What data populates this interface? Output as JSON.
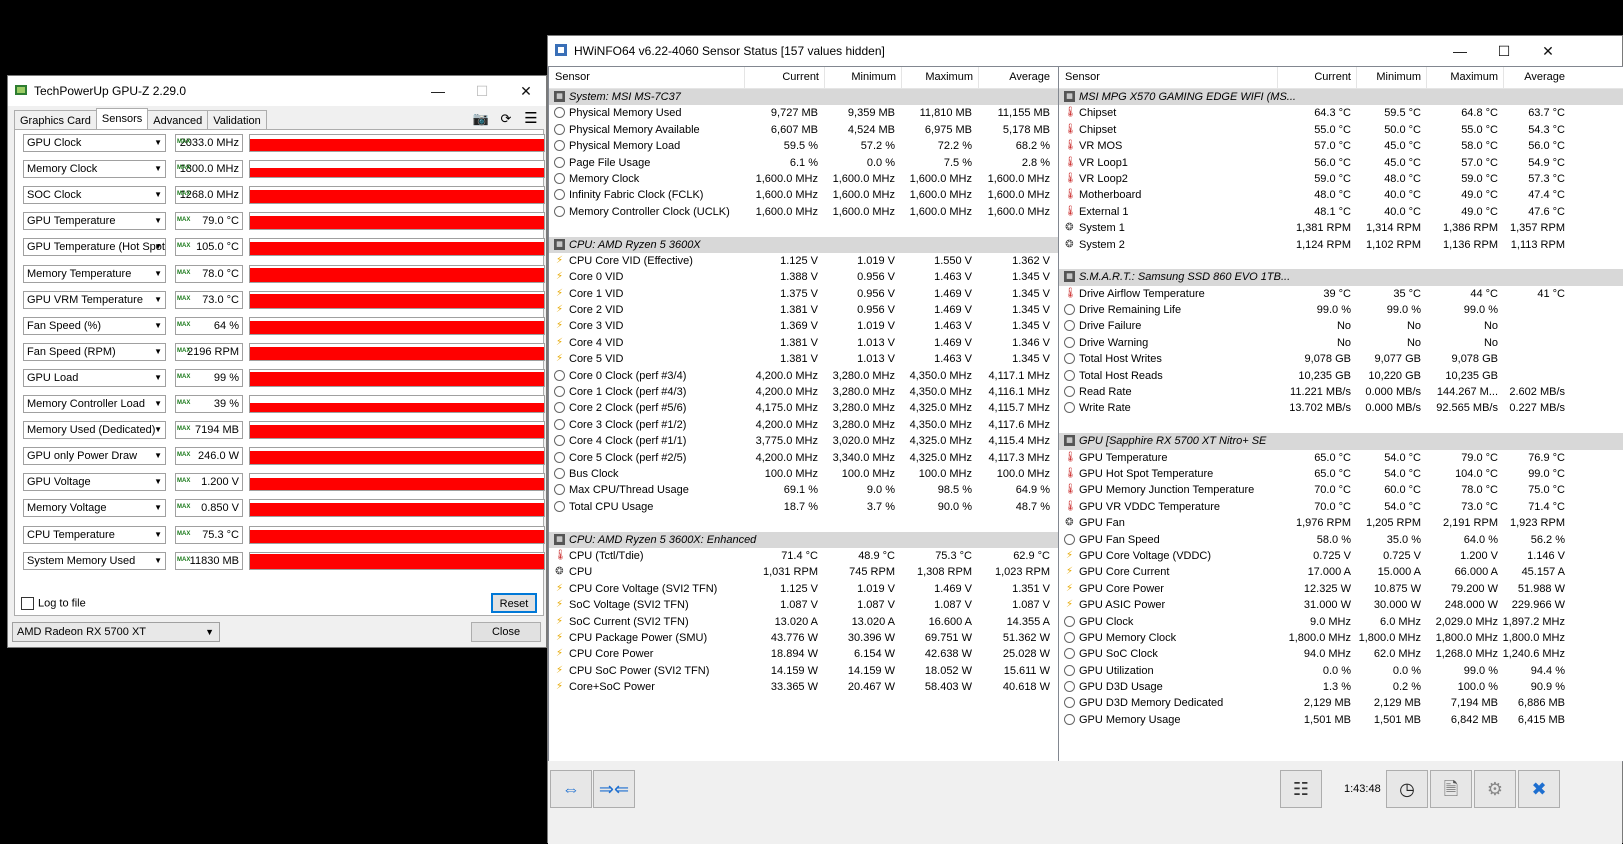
{
  "gpuz": {
    "title": "TechPowerUp GPU-Z 2.29.0",
    "tabs": [
      "Graphics Card",
      "Sensors",
      "Advanced",
      "Validation"
    ],
    "active_tab": 1,
    "max_badge": "MAX",
    "sensors": [
      {
        "name": "GPU Clock",
        "value": "2033.0 MHz",
        "level": 0.75
      },
      {
        "name": "Memory Clock",
        "value": "1800.0 MHz",
        "level": 0.6
      },
      {
        "name": "SOC Clock",
        "value": "1268.0 MHz",
        "level": 0.8
      },
      {
        "name": "GPU Temperature",
        "value": "79.0 °C",
        "level": 0.85
      },
      {
        "name": "GPU Temperature (Hot Spot)",
        "value": "105.0 °C",
        "level": 0.85
      },
      {
        "name": "Memory Temperature",
        "value": "78.0 °C",
        "level": 0.85
      },
      {
        "name": "GPU VRM Temperature",
        "value": "73.0 °C",
        "level": 0.85
      },
      {
        "name": "Fan Speed (%)",
        "value": "64 %",
        "level": 0.8
      },
      {
        "name": "Fan Speed (RPM)",
        "value": "2196 RPM",
        "level": 0.8
      },
      {
        "name": "GPU Load",
        "value": "99 %",
        "level": 0.9
      },
      {
        "name": "Memory Controller Load",
        "value": "39 %",
        "level": 0.55
      },
      {
        "name": "Memory Used (Dedicated)",
        "value": "7194 MB",
        "level": 0.85
      },
      {
        "name": "GPU only Power Draw",
        "value": "246.0 W",
        "level": 0.85
      },
      {
        "name": "GPU Voltage",
        "value": "1.200 V",
        "level": 0.75
      },
      {
        "name": "Memory Voltage",
        "value": "0.850 V",
        "level": 0.85
      },
      {
        "name": "CPU Temperature",
        "value": "75.3 °C",
        "level": 0.8
      },
      {
        "name": "System Memory Used",
        "value": "11830 MB",
        "level": 0.9
      }
    ],
    "log_label": "Log to file",
    "reset_label": "Reset",
    "gpu_select": "AMD Radeon RX 5700 XT",
    "close_label": "Close"
  },
  "hwinfo": {
    "title": "HWiNFO64 v6.22-4060 Sensor Status [157 values hidden]",
    "columns": [
      "Sensor",
      "Current",
      "Minimum",
      "Maximum",
      "Average"
    ],
    "left": [
      {
        "type": "group",
        "name": "System: MSI MS-7C37"
      },
      {
        "name": "Physical Memory Used",
        "icon": "clock",
        "v": [
          "9,727 MB",
          "9,359 MB",
          "11,810 MB",
          "11,155 MB"
        ]
      },
      {
        "name": "Physical Memory Available",
        "icon": "clock",
        "v": [
          "6,607 MB",
          "4,524 MB",
          "6,975 MB",
          "5,178 MB"
        ]
      },
      {
        "name": "Physical Memory Load",
        "icon": "clock",
        "v": [
          "59.5 %",
          "57.2 %",
          "72.2 %",
          "68.2 %"
        ]
      },
      {
        "name": "Page File Usage",
        "icon": "clock",
        "v": [
          "6.1 %",
          "0.0 %",
          "7.5 %",
          "2.8 %"
        ]
      },
      {
        "name": "Memory Clock",
        "icon": "clock",
        "v": [
          "1,600.0 MHz",
          "1,600.0 MHz",
          "1,600.0 MHz",
          "1,600.0 MHz"
        ]
      },
      {
        "name": "Infinity Fabric Clock (FCLK)",
        "icon": "clock",
        "v": [
          "1,600.0 MHz",
          "1,600.0 MHz",
          "1,600.0 MHz",
          "1,600.0 MHz"
        ]
      },
      {
        "name": "Memory Controller Clock (UCLK)",
        "icon": "clock",
        "v": [
          "1,600.0 MHz",
          "1,600.0 MHz",
          "1,600.0 MHz",
          "1,600.0 MHz"
        ]
      },
      {
        "type": "blank"
      },
      {
        "type": "group",
        "name": "CPU: AMD Ryzen 5 3600X"
      },
      {
        "name": "CPU Core VID (Effective)",
        "icon": "bolt",
        "v": [
          "1.125 V",
          "1.019 V",
          "1.550 V",
          "1.362 V"
        ]
      },
      {
        "name": "Core 0 VID",
        "icon": "bolt",
        "v": [
          "1.388 V",
          "0.956 V",
          "1.463 V",
          "1.345 V"
        ]
      },
      {
        "name": "Core 1 VID",
        "icon": "bolt",
        "v": [
          "1.375 V",
          "0.956 V",
          "1.469 V",
          "1.345 V"
        ]
      },
      {
        "name": "Core 2 VID",
        "icon": "bolt",
        "v": [
          "1.381 V",
          "0.956 V",
          "1.469 V",
          "1.345 V"
        ]
      },
      {
        "name": "Core 3 VID",
        "icon": "bolt",
        "v": [
          "1.369 V",
          "1.019 V",
          "1.463 V",
          "1.345 V"
        ]
      },
      {
        "name": "Core 4 VID",
        "icon": "bolt",
        "v": [
          "1.381 V",
          "1.013 V",
          "1.469 V",
          "1.346 V"
        ]
      },
      {
        "name": "Core 5 VID",
        "icon": "bolt",
        "v": [
          "1.381 V",
          "1.013 V",
          "1.463 V",
          "1.345 V"
        ]
      },
      {
        "name": "Core 0 Clock (perf #3/4)",
        "icon": "clock",
        "v": [
          "4,200.0 MHz",
          "3,280.0 MHz",
          "4,350.0 MHz",
          "4,117.1 MHz"
        ]
      },
      {
        "name": "Core 1 Clock (perf #4/3)",
        "icon": "clock",
        "v": [
          "4,200.0 MHz",
          "3,280.0 MHz",
          "4,350.0 MHz",
          "4,116.1 MHz"
        ]
      },
      {
        "name": "Core 2 Clock (perf #5/6)",
        "icon": "clock",
        "v": [
          "4,175.0 MHz",
          "3,280.0 MHz",
          "4,325.0 MHz",
          "4,115.7 MHz"
        ]
      },
      {
        "name": "Core 3 Clock (perf #1/2)",
        "icon": "clock",
        "v": [
          "4,200.0 MHz",
          "3,280.0 MHz",
          "4,350.0 MHz",
          "4,117.6 MHz"
        ]
      },
      {
        "name": "Core 4 Clock (perf #1/1)",
        "icon": "clock",
        "v": [
          "3,775.0 MHz",
          "3,020.0 MHz",
          "4,325.0 MHz",
          "4,115.4 MHz"
        ]
      },
      {
        "name": "Core 5 Clock (perf #2/5)",
        "icon": "clock",
        "v": [
          "4,200.0 MHz",
          "3,340.0 MHz",
          "4,325.0 MHz",
          "4,117.3 MHz"
        ]
      },
      {
        "name": "Bus Clock",
        "icon": "clock",
        "v": [
          "100.0 MHz",
          "100.0 MHz",
          "100.0 MHz",
          "100.0 MHz"
        ]
      },
      {
        "name": "Max CPU/Thread Usage",
        "icon": "clock",
        "v": [
          "69.1 %",
          "9.0 %",
          "98.5 %",
          "64.9 %"
        ]
      },
      {
        "name": "Total CPU Usage",
        "icon": "clock",
        "v": [
          "18.7 %",
          "3.7 %",
          "90.0 %",
          "48.7 %"
        ]
      },
      {
        "type": "blank"
      },
      {
        "type": "group",
        "name": "CPU: AMD Ryzen 5 3600X: Enhanced"
      },
      {
        "name": "CPU (Tctl/Tdie)",
        "icon": "therm",
        "v": [
          "71.4 °C",
          "48.9 °C",
          "75.3 °C",
          "62.9 °C"
        ]
      },
      {
        "name": "CPU",
        "icon": "fan",
        "v": [
          "1,031 RPM",
          "745 RPM",
          "1,308 RPM",
          "1,023 RPM"
        ]
      },
      {
        "name": "CPU Core Voltage (SVI2 TFN)",
        "icon": "bolt",
        "v": [
          "1.125 V",
          "1.019 V",
          "1.469 V",
          "1.351 V"
        ]
      },
      {
        "name": "SoC Voltage (SVI2 TFN)",
        "icon": "bolt",
        "v": [
          "1.087 V",
          "1.087 V",
          "1.087 V",
          "1.087 V"
        ]
      },
      {
        "name": "SoC Current (SVI2 TFN)",
        "icon": "bolt",
        "v": [
          "13.020 A",
          "13.020 A",
          "16.600 A",
          "14.355 A"
        ]
      },
      {
        "name": "CPU Package Power (SMU)",
        "icon": "bolt",
        "v": [
          "43.776 W",
          "30.396 W",
          "69.751 W",
          "51.362 W"
        ]
      },
      {
        "name": "CPU Core Power",
        "icon": "bolt",
        "v": [
          "18.894 W",
          "6.154 W",
          "42.638 W",
          "25.028 W"
        ]
      },
      {
        "name": "CPU SoC Power (SVI2 TFN)",
        "icon": "bolt",
        "v": [
          "14.159 W",
          "14.159 W",
          "18.052 W",
          "15.611 W"
        ]
      },
      {
        "name": "Core+SoC Power",
        "icon": "bolt",
        "v": [
          "33.365 W",
          "20.467 W",
          "58.403 W",
          "40.618 W"
        ]
      }
    ],
    "right": [
      {
        "type": "group",
        "name": "MSI MPG X570 GAMING EDGE WIFI (MS..."
      },
      {
        "name": "Chipset",
        "icon": "therm",
        "v": [
          "64.3 °C",
          "59.5 °C",
          "64.8 °C",
          "63.7 °C"
        ]
      },
      {
        "name": "Chipset",
        "icon": "therm",
        "v": [
          "55.0 °C",
          "50.0 °C",
          "55.0 °C",
          "54.3 °C"
        ]
      },
      {
        "name": "VR MOS",
        "icon": "therm",
        "v": [
          "57.0 °C",
          "45.0 °C",
          "58.0 °C",
          "56.0 °C"
        ]
      },
      {
        "name": "VR Loop1",
        "icon": "therm",
        "v": [
          "56.0 °C",
          "45.0 °C",
          "57.0 °C",
          "54.9 °C"
        ]
      },
      {
        "name": "VR Loop2",
        "icon": "therm",
        "v": [
          "59.0 °C",
          "48.0 °C",
          "59.0 °C",
          "57.3 °C"
        ]
      },
      {
        "name": "Motherboard",
        "icon": "therm",
        "v": [
          "48.0 °C",
          "40.0 °C",
          "49.0 °C",
          "47.4 °C"
        ]
      },
      {
        "name": "External 1",
        "icon": "therm",
        "v": [
          "48.1 °C",
          "40.0 °C",
          "49.0 °C",
          "47.6 °C"
        ]
      },
      {
        "name": "System 1",
        "icon": "fan",
        "v": [
          "1,381 RPM",
          "1,314 RPM",
          "1,386 RPM",
          "1,357 RPM"
        ]
      },
      {
        "name": "System 2",
        "icon": "fan",
        "v": [
          "1,124 RPM",
          "1,102 RPM",
          "1,136 RPM",
          "1,113 RPM"
        ]
      },
      {
        "type": "blank"
      },
      {
        "type": "group",
        "name": "S.M.A.R.T.: Samsung SSD 860 EVO 1TB..."
      },
      {
        "name": "Drive Airflow Temperature",
        "icon": "therm",
        "v": [
          "39 °C",
          "35 °C",
          "44 °C",
          "41 °C"
        ]
      },
      {
        "name": "Drive Remaining Life",
        "icon": "clock",
        "v": [
          "99.0 %",
          "99.0 %",
          "99.0 %",
          ""
        ]
      },
      {
        "name": "Drive Failure",
        "icon": "clock",
        "v": [
          "No",
          "No",
          "No",
          ""
        ]
      },
      {
        "name": "Drive Warning",
        "icon": "clock",
        "v": [
          "No",
          "No",
          "No",
          ""
        ]
      },
      {
        "name": "Total Host Writes",
        "icon": "clock",
        "v": [
          "9,078 GB",
          "9,077 GB",
          "9,078 GB",
          ""
        ]
      },
      {
        "name": "Total Host Reads",
        "icon": "clock",
        "v": [
          "10,235 GB",
          "10,220 GB",
          "10,235 GB",
          ""
        ]
      },
      {
        "name": "Read Rate",
        "icon": "clock",
        "v": [
          "11.221 MB/s",
          "0.000 MB/s",
          "144.267 M...",
          "2.602 MB/s"
        ]
      },
      {
        "name": "Write Rate",
        "icon": "clock",
        "v": [
          "13.702 MB/s",
          "0.000 MB/s",
          "92.565 MB/s",
          "0.227 MB/s"
        ]
      },
      {
        "type": "blank"
      },
      {
        "type": "group",
        "name": "GPU [Sapphire RX 5700 XT Nitro+ SE"
      },
      {
        "name": "GPU Temperature",
        "icon": "therm",
        "v": [
          "65.0 °C",
          "54.0 °C",
          "79.0 °C",
          "76.9 °C"
        ]
      },
      {
        "name": "GPU Hot Spot Temperature",
        "icon": "therm",
        "v": [
          "65.0 °C",
          "54.0 °C",
          "104.0 °C",
          "99.0 °C"
        ]
      },
      {
        "name": "GPU Memory Junction Temperature",
        "icon": "therm",
        "v": [
          "70.0 °C",
          "60.0 °C",
          "78.0 °C",
          "75.0 °C"
        ]
      },
      {
        "name": "GPU VR VDDC Temperature",
        "icon": "therm",
        "v": [
          "70.0 °C",
          "54.0 °C",
          "73.0 °C",
          "71.4 °C"
        ]
      },
      {
        "name": "GPU Fan",
        "icon": "fan",
        "v": [
          "1,976 RPM",
          "1,205 RPM",
          "2,191 RPM",
          "1,923 RPM"
        ]
      },
      {
        "name": "GPU Fan Speed",
        "icon": "clock",
        "v": [
          "58.0 %",
          "35.0 %",
          "64.0 %",
          "56.2 %"
        ]
      },
      {
        "name": "GPU Core Voltage (VDDC)",
        "icon": "bolt",
        "v": [
          "0.725 V",
          "0.725 V",
          "1.200 V",
          "1.146 V"
        ]
      },
      {
        "name": "GPU Core Current",
        "icon": "bolt",
        "v": [
          "17.000 A",
          "15.000 A",
          "66.000 A",
          "45.157 A"
        ]
      },
      {
        "name": "GPU Core Power",
        "icon": "bolt",
        "v": [
          "12.325 W",
          "10.875 W",
          "79.200 W",
          "51.988 W"
        ]
      },
      {
        "name": "GPU ASIC Power",
        "icon": "bolt",
        "v": [
          "31.000 W",
          "30.000 W",
          "248.000 W",
          "229.966 W"
        ]
      },
      {
        "name": "GPU Clock",
        "icon": "clock",
        "v": [
          "9.0 MHz",
          "6.0 MHz",
          "2,029.0 MHz",
          "1,897.2 MHz"
        ]
      },
      {
        "name": "GPU Memory Clock",
        "icon": "clock",
        "v": [
          "1,800.0 MHz",
          "1,800.0 MHz",
          "1,800.0 MHz",
          "1,800.0 MHz"
        ]
      },
      {
        "name": "GPU SoC Clock",
        "icon": "clock",
        "v": [
          "94.0 MHz",
          "62.0 MHz",
          "1,268.0 MHz",
          "1,240.6 MHz"
        ]
      },
      {
        "name": "GPU Utilization",
        "icon": "clock",
        "v": [
          "0.0 %",
          "0.0 %",
          "99.0 %",
          "94.4 %"
        ]
      },
      {
        "name": "GPU D3D Usage",
        "icon": "clock",
        "v": [
          "1.3 %",
          "0.2 %",
          "100.0 %",
          "90.9 %"
        ]
      },
      {
        "name": "GPU D3D Memory Dedicated",
        "icon": "clock",
        "v": [
          "2,129 MB",
          "2,129 MB",
          "7,194 MB",
          "6,886 MB"
        ]
      },
      {
        "name": "GPU Memory Usage",
        "icon": "clock",
        "v": [
          "1,501 MB",
          "1,501 MB",
          "6,842 MB",
          "6,415 MB"
        ]
      }
    ],
    "timer": "1:43:48",
    "colors": {
      "graph": "#ff0000",
      "accent": "#1e6fd0",
      "group_bg": "#d8d8d8"
    }
  }
}
